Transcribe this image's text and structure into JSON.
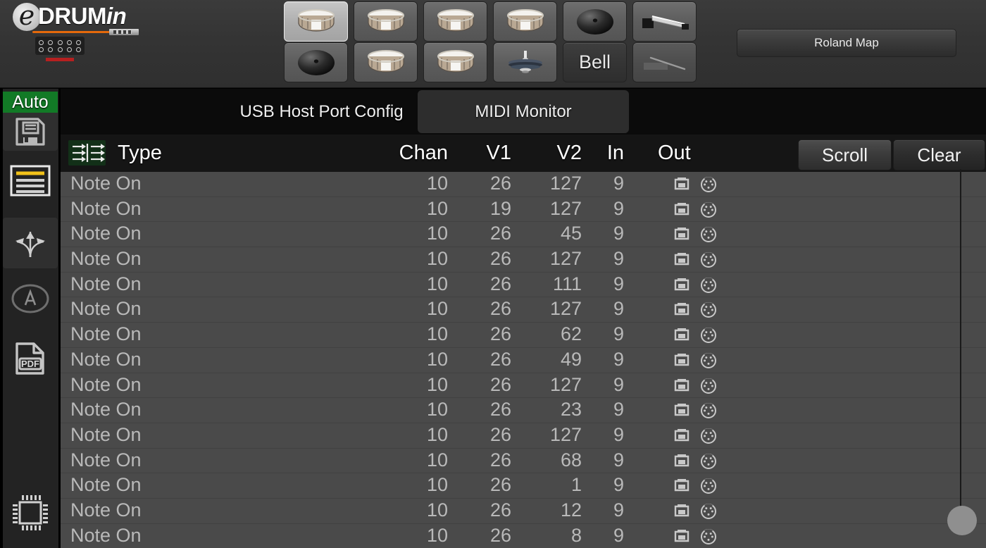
{
  "app": {
    "brand_prefix": "DRUM",
    "brand_suffix": "in",
    "brand_e": "e"
  },
  "topbar": {
    "pads": [
      {
        "name": "pad-snare-1",
        "icon": "snare-drum-icon",
        "label": "",
        "state": "selected"
      },
      {
        "name": "pad-snare-2",
        "icon": "snare-drum-icon",
        "label": "",
        "state": "normal"
      },
      {
        "name": "pad-snare-3",
        "icon": "snare-drum-icon",
        "label": "",
        "state": "normal"
      },
      {
        "name": "pad-snare-4",
        "icon": "snare-drum-icon",
        "label": "",
        "state": "normal"
      },
      {
        "name": "pad-cymbal-1",
        "icon": "cymbal-icon",
        "label": "",
        "state": "normal"
      },
      {
        "name": "pad-hihat-pedal",
        "icon": "hihat-pedal-icon",
        "label": "",
        "state": "normal"
      },
      {
        "name": "pad-cymbal-2",
        "icon": "cymbal-icon",
        "label": "",
        "state": "normal"
      },
      {
        "name": "pad-snare-5",
        "icon": "snare-drum-icon",
        "label": "",
        "state": "normal"
      },
      {
        "name": "pad-snare-6",
        "icon": "snare-drum-icon",
        "label": "",
        "state": "normal"
      },
      {
        "name": "pad-hihat",
        "icon": "hihat-cymbal-icon",
        "label": "",
        "state": "normal"
      },
      {
        "name": "pad-bell",
        "icon": "text-label",
        "label": "Bell",
        "state": "dark"
      },
      {
        "name": "pad-pedal-disabled",
        "icon": "pedal-disabled-icon",
        "label": "",
        "state": "dim"
      }
    ],
    "roland_map_label": "Roland Map"
  },
  "sidebar": {
    "auto_label": "Auto",
    "items": [
      {
        "name": "sidebar-item-save",
        "icon": "floppy-disk-icon"
      },
      {
        "name": "sidebar-item-list",
        "icon": "list-lines-icon"
      },
      {
        "name": "sidebar-item-routing",
        "icon": "arrows-spread-icon"
      },
      {
        "name": "sidebar-item-about",
        "icon": "circled-a-icon"
      },
      {
        "name": "sidebar-item-pdf",
        "icon": "pdf-file-icon"
      },
      {
        "name": "sidebar-item-firmware",
        "icon": "microchip-icon"
      }
    ]
  },
  "tabs": [
    {
      "label": "USB Host Port Config",
      "active": false
    },
    {
      "label": "MIDI Monitor",
      "active": true
    }
  ],
  "monitor": {
    "filter_icon": "midi-filter-icon",
    "scroll_label": "Scroll",
    "clear_label": "Clear",
    "columns": [
      "Type",
      "Chan",
      "V1",
      "V2",
      "In",
      "Out"
    ],
    "out_icons": [
      "usb-port-icon",
      "midi-din-icon"
    ],
    "rows": [
      {
        "type": "Note On",
        "chan": "10",
        "v1": "26",
        "v2": "127",
        "in": "9"
      },
      {
        "type": "Note On",
        "chan": "10",
        "v1": "19",
        "v2": "127",
        "in": "9"
      },
      {
        "type": "Note On",
        "chan": "10",
        "v1": "26",
        "v2": "45",
        "in": "9"
      },
      {
        "type": "Note On",
        "chan": "10",
        "v1": "26",
        "v2": "127",
        "in": "9"
      },
      {
        "type": "Note On",
        "chan": "10",
        "v1": "26",
        "v2": "111",
        "in": "9"
      },
      {
        "type": "Note On",
        "chan": "10",
        "v1": "26",
        "v2": "127",
        "in": "9"
      },
      {
        "type": "Note On",
        "chan": "10",
        "v1": "26",
        "v2": "62",
        "in": "9"
      },
      {
        "type": "Note On",
        "chan": "10",
        "v1": "26",
        "v2": "49",
        "in": "9"
      },
      {
        "type": "Note On",
        "chan": "10",
        "v1": "26",
        "v2": "127",
        "in": "9"
      },
      {
        "type": "Note On",
        "chan": "10",
        "v1": "26",
        "v2": "23",
        "in": "9"
      },
      {
        "type": "Note On",
        "chan": "10",
        "v1": "26",
        "v2": "127",
        "in": "9"
      },
      {
        "type": "Note On",
        "chan": "10",
        "v1": "26",
        "v2": "68",
        "in": "9"
      },
      {
        "type": "Note On",
        "chan": "10",
        "v1": "26",
        "v2": "1",
        "in": "9"
      },
      {
        "type": "Note On",
        "chan": "10",
        "v1": "26",
        "v2": "12",
        "in": "9"
      },
      {
        "type": "Note On",
        "chan": "10",
        "v1": "26",
        "v2": "8",
        "in": "9"
      }
    ]
  },
  "colors": {
    "auto_green": "#127a26",
    "accent_orange": "#e4690b",
    "accent_yellow": "#f2c21a",
    "accent_red": "#b62020",
    "table_bg": "#4a4a4a"
  }
}
